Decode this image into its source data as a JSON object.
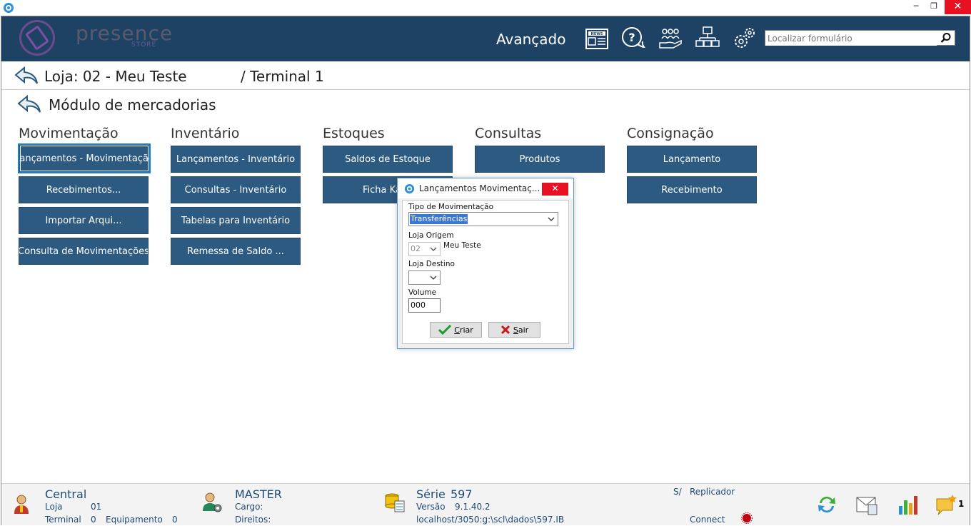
{
  "header": {
    "logo_text": "presence",
    "logo_sub": "STORE",
    "advanced_label": "Avançado",
    "search_placeholder": "Localizar formulário"
  },
  "breadcrumb": {
    "store": "Loja: 02 - Meu Teste",
    "terminal": "/ Terminal 1",
    "module": "Módulo de mercadorias"
  },
  "sections": [
    {
      "title": "Movimentação",
      "buttons": [
        "Lançamentos - Movimentação",
        "Recebimentos...",
        "Importar Arqui...",
        "Consulta de Movimentações"
      ]
    },
    {
      "title": "Inventário",
      "buttons": [
        "Lançamentos - Inventário",
        "Consultas - Inventário",
        "Tabelas para Inventário",
        "Remessa de Saldo ..."
      ]
    },
    {
      "title": "Estoques",
      "buttons": [
        "Saldos de Estoque",
        "Ficha Ka"
      ]
    },
    {
      "title": "Consultas",
      "buttons": [
        "Produtos"
      ]
    },
    {
      "title": "Consignação",
      "buttons": [
        "Lançamento",
        "Recebimento"
      ]
    }
  ],
  "dialog": {
    "title": "Lançamentos Movimentaç...",
    "tipo_label": "Tipo de Movimentação",
    "tipo_value": "Transferências",
    "origem_label": "Loja Origem",
    "origem_value": "02",
    "origem_name": "Meu Teste",
    "destino_label": "Loja Destino",
    "destino_value": "",
    "volume_label": "Volume",
    "volume_value": "000",
    "criar_label_first": "C",
    "criar_label_rest": "riar",
    "sair_label_first": "S",
    "sair_label_rest": "air"
  },
  "footer": {
    "central": "Central",
    "loja_label": "Loja",
    "loja_value": "01",
    "terminal_label": "Terminal",
    "terminal_value": "0",
    "equipamento_label": "Equipamento",
    "equipamento_value": "0",
    "user": "MASTER",
    "cargo_label": "Cargo:",
    "direitos_label": "Direitos:",
    "serie_label": "Série",
    "serie_value": "597",
    "versao_label": "Versão",
    "versao_value": "9.1.40.2",
    "db_path": "localhost/3050:g:\\scl\\dados\\597.IB",
    "sa_label": "S/",
    "replicador_label": "Replicador",
    "connect_label": "Connect",
    "notif_count": "1"
  },
  "colors": {
    "header_bg": "#1e4264",
    "button_bg": "#2d5a80",
    "close_red": "#e81123",
    "footer_text": "#1e4a78"
  }
}
